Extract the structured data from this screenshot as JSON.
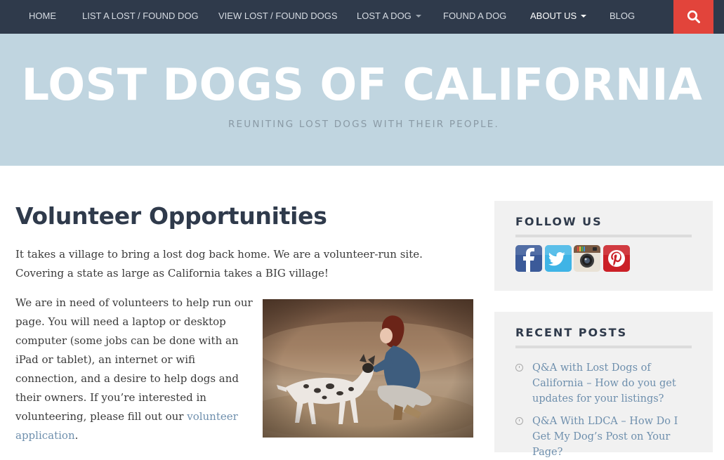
{
  "nav": {
    "items": [
      {
        "label": "HOME"
      },
      {
        "label": "LIST A LOST / FOUND DOG"
      },
      {
        "label": "VIEW LOST / FOUND DOGS"
      },
      {
        "label": "LOST A DOG"
      },
      {
        "label": "FOUND A DOG"
      },
      {
        "label": "ABOUT US"
      },
      {
        "label": "BLOG"
      }
    ],
    "search_icon": "search-icon"
  },
  "header": {
    "title": "LOST DOGS OF CALIFORNIA",
    "tagline": "REUNITING LOST DOGS WITH THEIR PEOPLE."
  },
  "main": {
    "title": "Volunteer Opportunities",
    "paragraph1": "It takes a village to bring a lost dog back home. We are a volunteer-run site. Covering a state as large as California takes a BIG village!",
    "paragraph2_text": "We are in need of volunteers to help run our page. You will need a laptop or desktop computer (some jobs can be done with an iPad or tablet), an internet or wifi connection, and a desire to help dogs and their owners. If you’re interested in volunteering, please fill out our ",
    "paragraph2_link": "volunteer application",
    "paragraph2_end": "."
  },
  "sidebar": {
    "follow_title": "FOLLOW US",
    "social_icons": [
      "facebook-icon",
      "twitter-icon",
      "instagram-icon",
      "pinterest-icon"
    ],
    "recent_title": "RECENT POSTS",
    "posts": [
      {
        "title": "Q&A with Lost Dogs of California – How do you get updates for your listings?"
      },
      {
        "title": "Q&A With LDCA – How Do I Get My Dog’s Post on Your Page?"
      }
    ]
  },
  "colors": {
    "nav_bg": "#2f3a4b",
    "search_bg": "#e2443b",
    "header_bg": "#c0d5e0",
    "link": "#6e8fad",
    "widget_bg": "#f1f1f1"
  }
}
